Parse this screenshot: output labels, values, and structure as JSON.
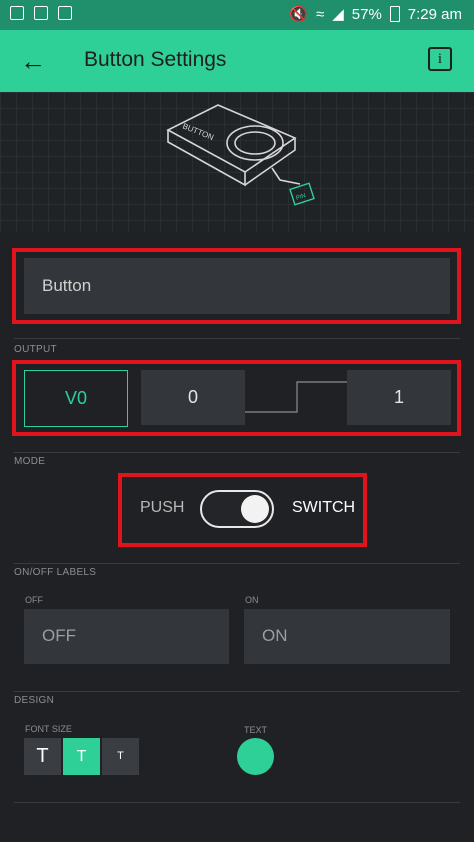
{
  "status_bar": {
    "battery": "57%",
    "time": "7:29 am"
  },
  "app_bar": {
    "back_icon": "arrow-left-icon",
    "title": "Button Settings",
    "info_label": "i"
  },
  "name_field": {
    "value": "Button"
  },
  "output": {
    "section_label": "OUTPUT",
    "pin": "V0",
    "low_value": "0",
    "high_value": "1"
  },
  "mode": {
    "section_label": "MODE",
    "push_label": "PUSH",
    "switch_label": "SWITCH",
    "selected": "SWITCH"
  },
  "labels": {
    "section_label": "ON/OFF LABELS",
    "off_caption": "OFF",
    "on_caption": "ON",
    "off_value": "OFF",
    "on_value": "ON"
  },
  "design": {
    "section_label": "DESIGN",
    "font_size_caption": "FONT SIZE",
    "text_caption": "TEXT",
    "font_sizes": [
      "T",
      "T",
      "T"
    ],
    "selected_font_index": 1,
    "text_color": "#2fcf98"
  },
  "colors": {
    "accent": "#2fcf98",
    "highlight_box": "#e0141c"
  }
}
